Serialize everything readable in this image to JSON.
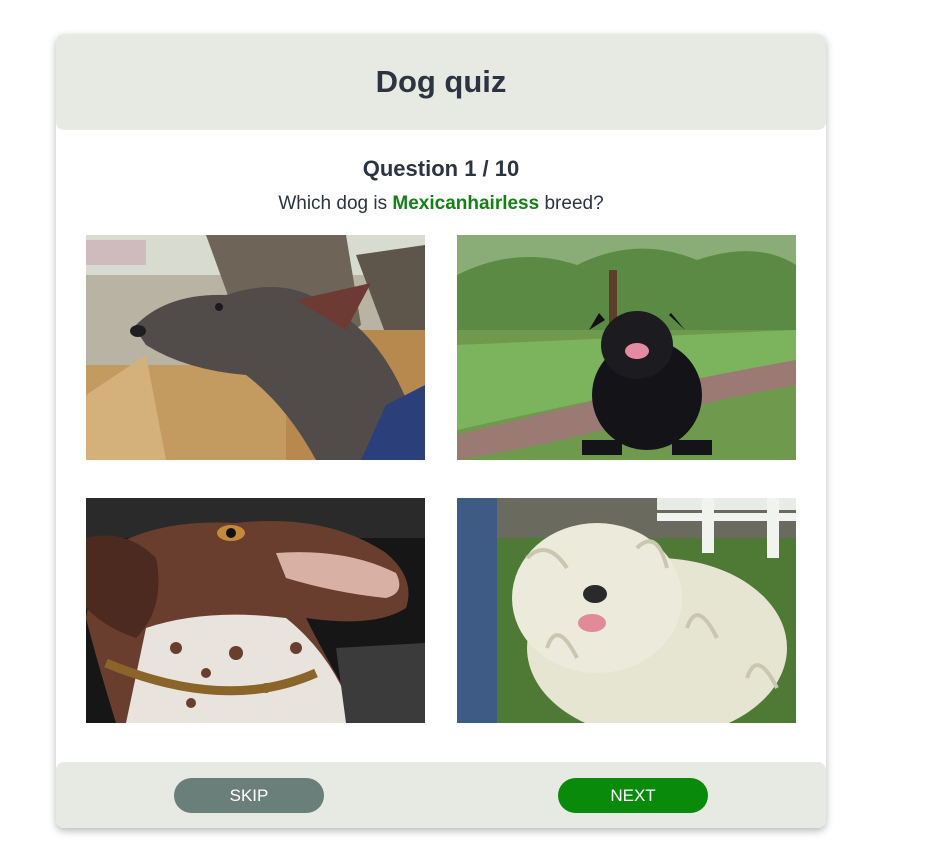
{
  "quiz": {
    "title": "Dog quiz",
    "question_label": "Question 1 / 10",
    "prompt_before": "Which dog is",
    "breed": "Mexicanhairless",
    "prompt_after": "breed?"
  },
  "options": [
    {
      "description": "Grey hairless dog in a cardboard box"
    },
    {
      "description": "Black shaggy dog sitting on a grassy path"
    },
    {
      "description": "Brown and white spotted pointer close-up"
    },
    {
      "description": "White corded-coat dog on grass"
    }
  ],
  "buttons": {
    "skip": "SKIP",
    "next": "NEXT"
  },
  "colors": {
    "header_bg": "#e7eae3",
    "breed_highlight": "#128212",
    "skip_button": "#6b7f7a",
    "next_button": "#0a8a0a"
  }
}
